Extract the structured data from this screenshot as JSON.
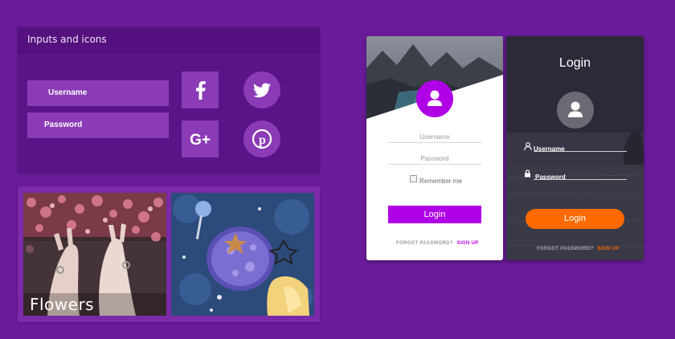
{
  "inputs_panel": {
    "title": "Inputs and icons",
    "username_placeholder": "Username",
    "password_placeholder": "Password",
    "social_icons": [
      "facebook-icon",
      "twitter-icon",
      "google-plus-icon",
      "pinterest-icon"
    ]
  },
  "gallery": {
    "caption": "Flowers"
  },
  "login_light": {
    "username_label": "Username",
    "password_label": "Password",
    "remember_label": "Remember me",
    "login_button": "Login",
    "forgot_text": "FORGOT PASSWORD?",
    "signup_text": "SIGN UP",
    "accent": "#b000e6"
  },
  "login_dark": {
    "title": "Login",
    "username_label": "Username",
    "password_label": "Password",
    "login_button": "Login",
    "forgot_text": "FORGOT PASSWORD?",
    "signup_text": "SIGN UP",
    "accent": "#ff6a00"
  },
  "colors": {
    "background": "#6a1b9a",
    "panel": "#5a1488",
    "input": "#8a3bb5"
  }
}
